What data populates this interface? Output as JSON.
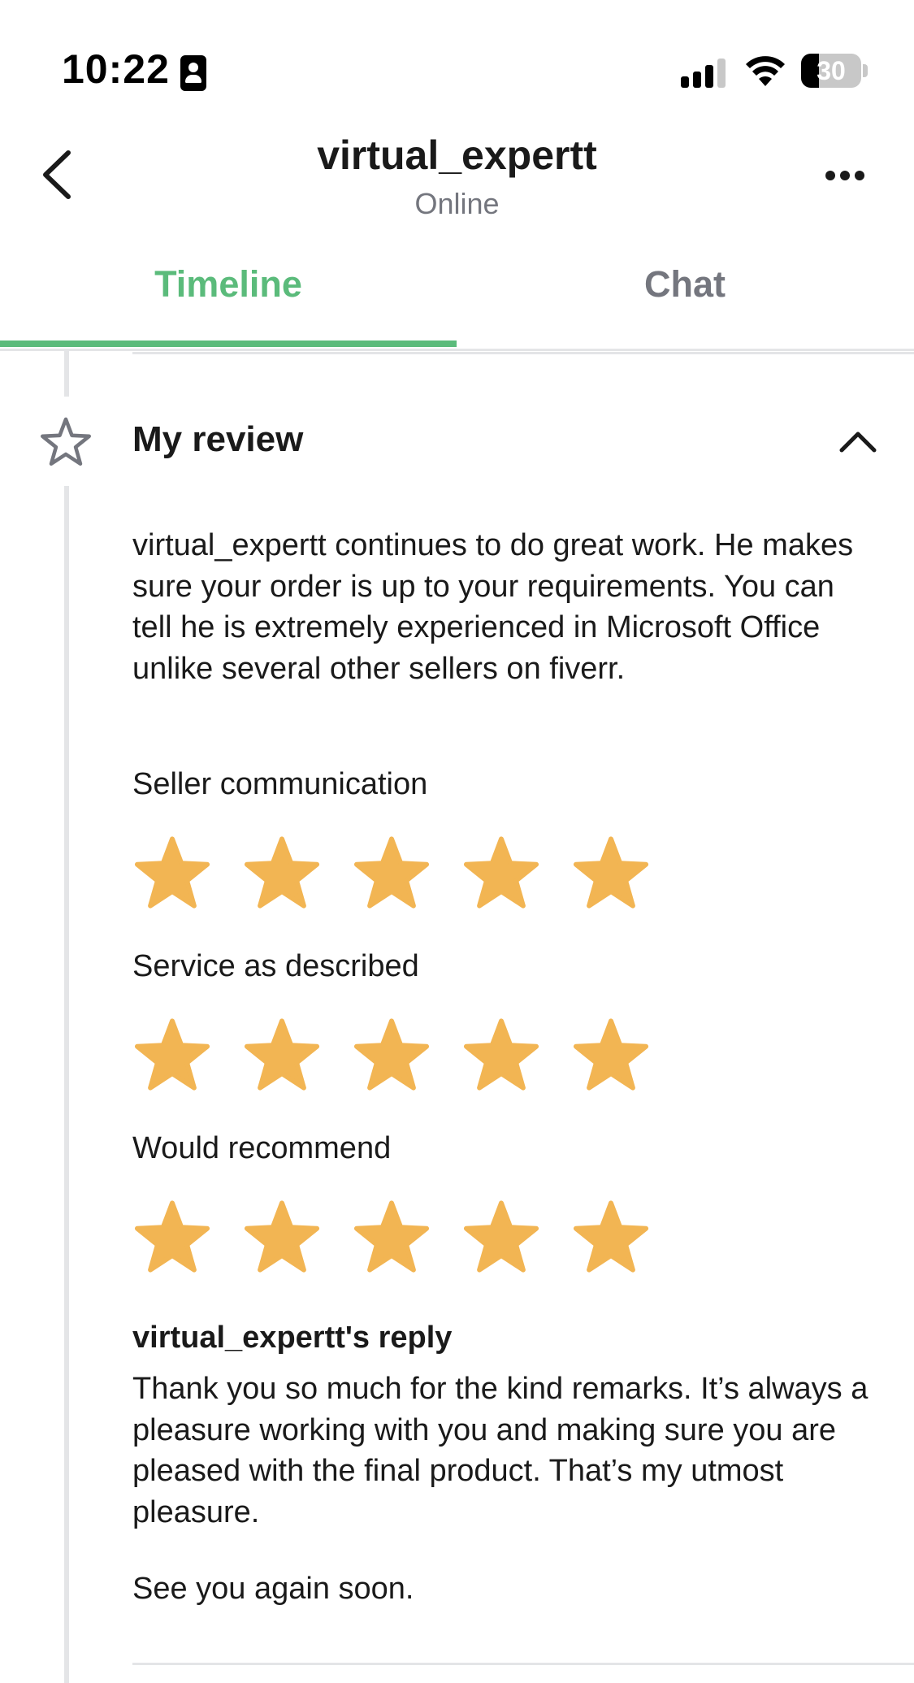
{
  "status_bar": {
    "time": "10:22",
    "battery": "30",
    "battery_level": 0.3,
    "icons": [
      "contact-card-icon",
      "signal-icon",
      "wifi-icon",
      "battery-icon"
    ]
  },
  "header": {
    "title": "virtual_expertt",
    "subtitle": "Online",
    "icons": [
      "chevron-left-icon",
      "more-horizontal-icon"
    ]
  },
  "tabs": [
    {
      "label": "Timeline",
      "active": true
    },
    {
      "label": "Chat",
      "active": false
    }
  ],
  "review": {
    "title": "My review",
    "text": "virtual_expertt continues to do great work. He makes sure your order is up to your requirements. You can tell he is extremely experienced in Microsoft Office unlike several other sellers on fiverr.",
    "ratings": [
      {
        "label": "Seller communication",
        "stars": 5,
        "max": 5
      },
      {
        "label": "Service as described",
        "stars": 5,
        "max": 5
      },
      {
        "label": "Would recommend",
        "stars": 5,
        "max": 5
      }
    ],
    "reply_title": "virtual_expertt's reply",
    "reply_text": "Thank you so much for the kind remarks. It’s always a pleasure working with you and making sure you are pleased with the final product. That’s my utmost pleasure.",
    "reply_closing": "See you again soon."
  },
  "colors": {
    "accent": "#5bbb7b",
    "star": "#f2b553",
    "muted": "#74767e",
    "divider": "#e4e5e7",
    "text": "#1a1a1a"
  }
}
